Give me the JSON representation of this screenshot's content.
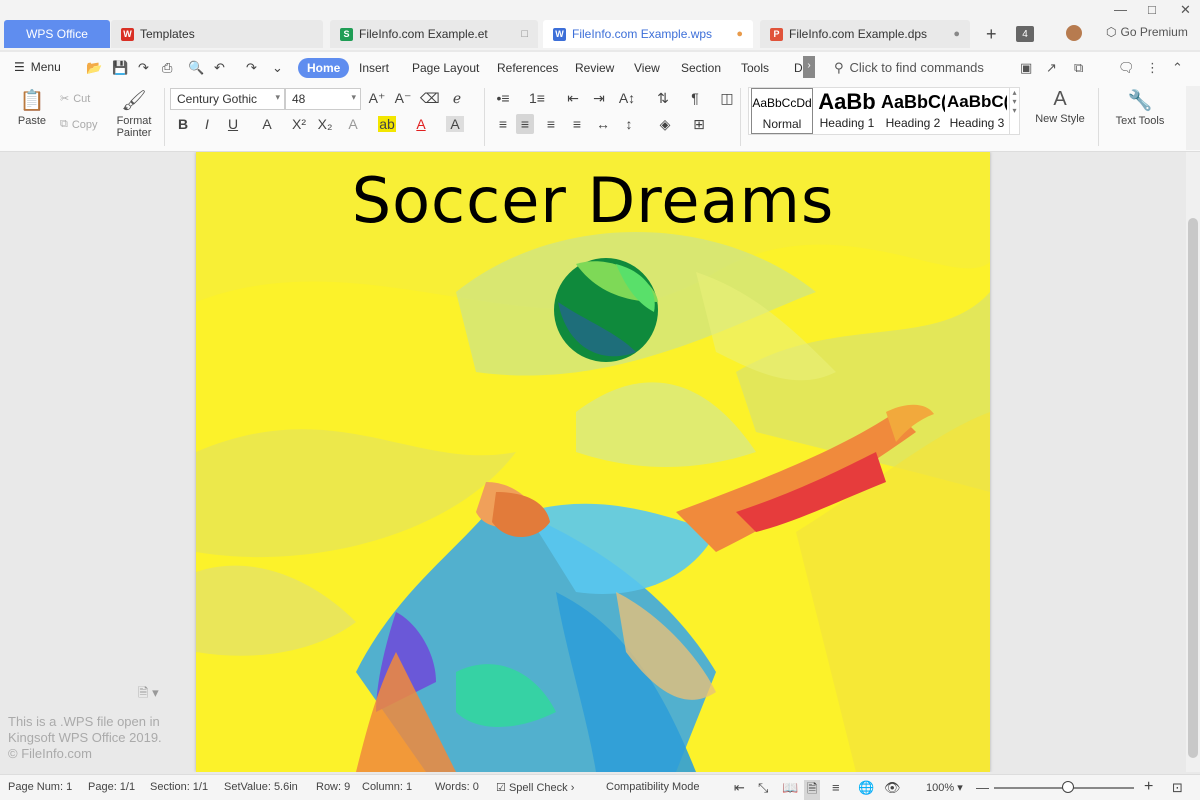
{
  "tabs": [
    {
      "label": "WPS Office"
    },
    {
      "label": "Templates"
    },
    {
      "label": "FileInfo.com Example.et"
    },
    {
      "label": "FileInfo.com Example.wps"
    },
    {
      "label": "FileInfo.com Example.dps"
    }
  ],
  "tab_count": "4",
  "premium_label": "Go Premium",
  "menu": {
    "label": "Menu",
    "tabs": [
      "Home",
      "Insert",
      "Page Layout",
      "References",
      "Review",
      "View",
      "Section",
      "Tools",
      "D"
    ],
    "find_placeholder": "Click to find commands"
  },
  "ribbon": {
    "paste": "Paste",
    "cut": "Cut",
    "copy": "Copy",
    "format_painter_1": "Format",
    "format_painter_2": "Painter",
    "font": "Century Gothic",
    "size": "48",
    "styles": [
      {
        "preview": "AaBbCcDd",
        "label": "Normal"
      },
      {
        "preview": "AaBb",
        "label": "Heading 1"
      },
      {
        "preview": "AaBbC(",
        "label": "Heading 2"
      },
      {
        "preview": "AaBbC(",
        "label": "Heading 3"
      }
    ],
    "new_style": "New Style",
    "text_tools": "Text Tools"
  },
  "document": {
    "title": "Soccer Dreams"
  },
  "watermark": {
    "line1": "This is a .WPS file open in",
    "line2": "Kingsoft WPS Office 2019.",
    "line3": "© FileInfo.com"
  },
  "status": {
    "page_num": "Page Num: 1",
    "page": "Page: 1/1",
    "section": "Section: 1/1",
    "setvalue": "SetValue: 5.6in",
    "row": "Row: 9",
    "column": "Column: 1",
    "words": "Words: 0",
    "spell": "Spell Check",
    "compat": "Compatibility Mode",
    "zoom": "100%"
  },
  "colors": {
    "accent": "#5f8def",
    "page_background": "#fcf22a"
  }
}
